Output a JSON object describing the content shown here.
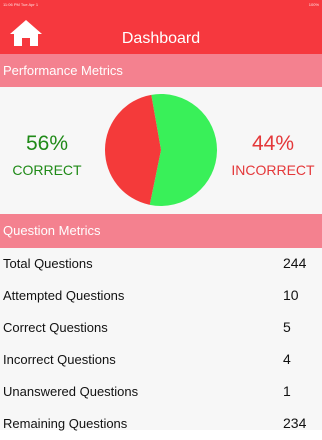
{
  "status_bar": {
    "time": "11:06 PM",
    "date": "Tue Apr 1",
    "battery": "100%"
  },
  "header": {
    "title": "Dashboard",
    "home_icon": "home-icon"
  },
  "performance": {
    "section_title": "Performance Metrics",
    "correct_percent": "56%",
    "correct_label": "CORRECT",
    "incorrect_percent": "44%",
    "incorrect_label": "INCORRECT",
    "colors": {
      "correct": "#39f059",
      "incorrect": "#f43a3a"
    }
  },
  "chart_data": {
    "type": "pie",
    "categories": [
      "CORRECT",
      "INCORRECT"
    ],
    "values": [
      56,
      44
    ],
    "colors": [
      "#39f059",
      "#f43a3a"
    ]
  },
  "question_metrics": {
    "section_title": "Question Metrics",
    "rows": [
      {
        "label": "Total Questions",
        "value": "244"
      },
      {
        "label": "Attempted Questions",
        "value": "10"
      },
      {
        "label": "Correct Questions",
        "value": "5"
      },
      {
        "label": "Incorrect Questions",
        "value": "4"
      },
      {
        "label": "Unanswered Questions",
        "value": "1"
      },
      {
        "label": "Remaining Questions",
        "value": "234"
      }
    ]
  },
  "theme": {
    "primary": "#f6383e",
    "section_header": "#f4818f",
    "background": "#f7f7f7"
  }
}
